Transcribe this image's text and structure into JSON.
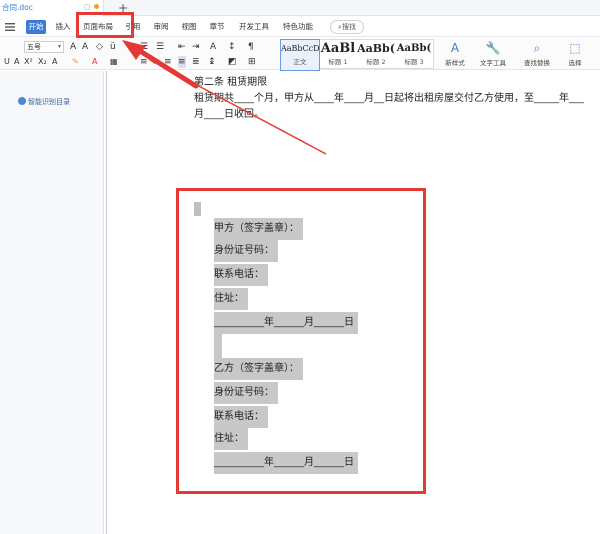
{
  "titlebar": {
    "doc_name": "合同.doc",
    "new_tab_label": "+"
  },
  "ribbon_tabs": [
    {
      "label": "开始",
      "active": true
    },
    {
      "label": "插入",
      "active": false
    },
    {
      "label": "页面布局",
      "active": false
    },
    {
      "label": "引用",
      "active": false
    },
    {
      "label": "审阅",
      "active": false
    },
    {
      "label": "视图",
      "active": false
    },
    {
      "label": "章节",
      "active": false
    },
    {
      "label": "开发工具",
      "active": false
    },
    {
      "label": "特色功能",
      "active": false
    }
  ],
  "search_label": "搜找",
  "toolbar": {
    "font_size": "五号",
    "styles": [
      {
        "preview": "AaBbCcDd",
        "name": "正文"
      },
      {
        "preview": "AaBl",
        "name": "标题 1"
      },
      {
        "preview": "AaBb(",
        "name": "标题 2"
      },
      {
        "preview": "AaBb(",
        "name": "标题 3"
      }
    ],
    "new_style": "新样式",
    "text_tools": "文字工具",
    "find_replace": "查找替换",
    "select": "选择"
  },
  "left_pane": {
    "smart_toc": "智能识别目录"
  },
  "document": {
    "line1": "第二条 租赁期限",
    "line2": "租赁期共____个月，甲方从____年____月__日起将出租房屋交付乙方使用，至_____年___",
    "line3": "月____日收回。",
    "party_a": {
      "title": "甲方（签字盖章）：",
      "id": "身份证号码：",
      "phone": "联系电话：",
      "address": "住址：",
      "date": "__________年______月______日"
    },
    "party_b": {
      "title": "乙方（签字盖章）：",
      "id": "身份证号码：",
      "phone": "联系电话：",
      "address": "住址：",
      "date": "__________年______月______日"
    }
  },
  "colors": {
    "accent": "#3a7bd5",
    "annotation_red": "#e53935",
    "highlight_gray": "#c8c8c8"
  }
}
